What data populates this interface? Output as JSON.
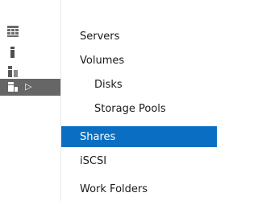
{
  "rail": {
    "items": [
      {
        "icon": "servers-icon"
      },
      {
        "icon": "volume-icon"
      },
      {
        "icon": "disks-icon"
      },
      {
        "icon": "file-storage-services-icon",
        "active": true,
        "expand_glyph": "▷"
      }
    ]
  },
  "menu": {
    "items": [
      {
        "label": "Servers"
      },
      {
        "label": "Volumes"
      },
      {
        "label": "Disks"
      },
      {
        "label": "Storage Pools"
      },
      {
        "label": "Shares"
      },
      {
        "label": "iSCSI"
      },
      {
        "label": "Work Folders"
      }
    ],
    "selected": "Shares"
  },
  "colors": {
    "selection": "#0a6fc2",
    "rail_active": "#666666",
    "icon_gray": "#595959"
  }
}
